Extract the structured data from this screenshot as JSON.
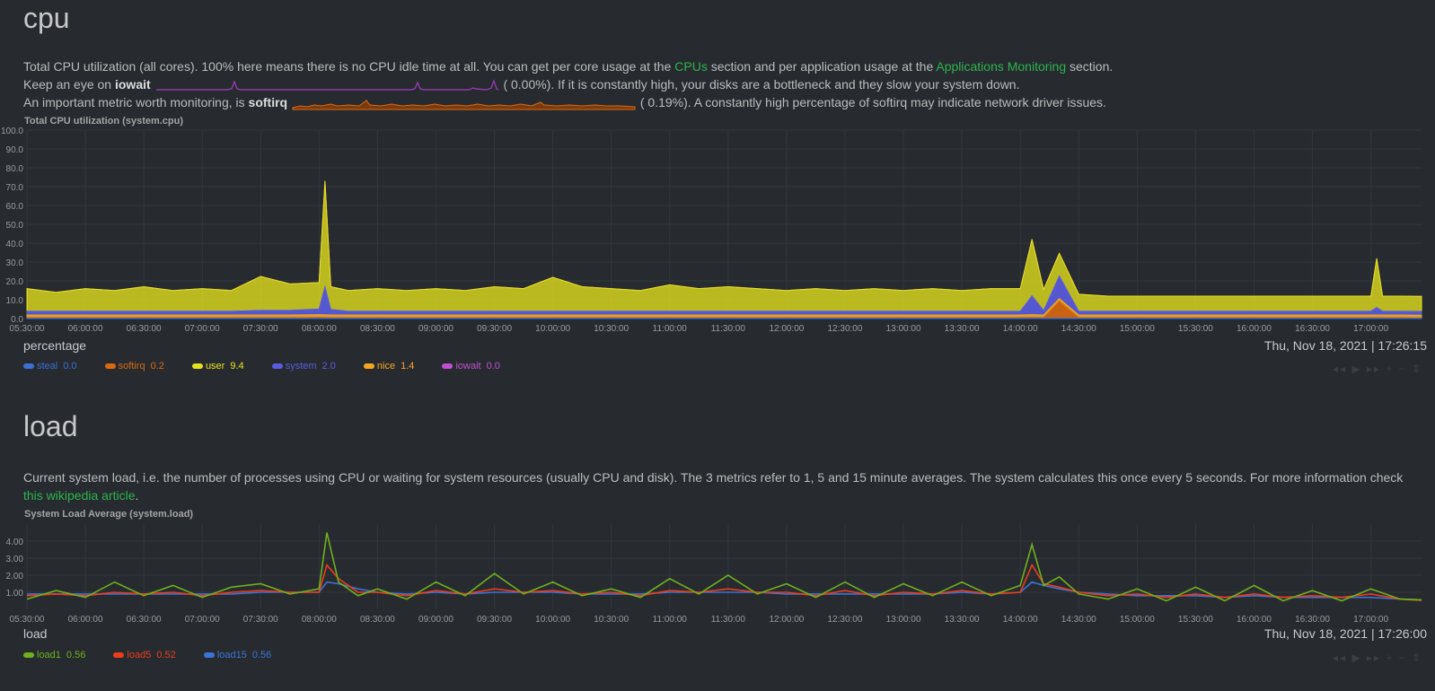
{
  "cpu": {
    "title": "cpu",
    "desc1_pre": "Total CPU utilization (all cores). 100% here means there is no CPU idle time at all. You can get per core usage at the ",
    "desc1_link1": "CPUs",
    "desc1_mid": " section and per application usage at the ",
    "desc1_link2": "Applications Monitoring",
    "desc1_post": " section.",
    "desc2_pre": "Keep an eye on ",
    "desc2_bold": "iowait",
    "desc2_val": "(       0.00%). If it is constantly high, your disks are a bottleneck and they slow your system down.",
    "desc3_pre": "An important metric worth monitoring, is ",
    "desc3_bold": "softirq",
    "desc3_val": "(       0.19%). A constantly high percentage of softirq may indicate network driver issues.",
    "chart_title": "Total CPU utilization (system.cpu)",
    "units": "percentage",
    "timestamp": "Thu, Nov 18, 2021 | 17:26:15",
    "legend": [
      {
        "name": "steal",
        "value": "0.0",
        "color": "#3b6fd6"
      },
      {
        "name": "softirq",
        "value": "0.2",
        "color": "#d9690f"
      },
      {
        "name": "user",
        "value": "9.4",
        "color": "#e5e21c"
      },
      {
        "name": "system",
        "value": "2.0",
        "color": "#5a5ce0"
      },
      {
        "name": "nice",
        "value": "1.4",
        "color": "#f5a623"
      },
      {
        "name": "iowait",
        "value": "0.0",
        "color": "#c04fd1"
      }
    ]
  },
  "load": {
    "title": "load",
    "desc1": "Current system load, i.e. the number of processes using CPU or waiting for system resources (usually CPU and disk). The 3 metrics refer to 1, 5 and 15 minute averages. The system calculates this once every 5 seconds. For more information check",
    "desc2_link": "this wikipedia article",
    "desc2_post": ".",
    "chart_title": "System Load Average (system.load)",
    "units": "load",
    "timestamp": "Thu, Nov 18, 2021 | 17:26:00",
    "legend": [
      {
        "name": "load1",
        "value": "0.56",
        "color": "#6fb01e"
      },
      {
        "name": "load5",
        "value": "0.52",
        "color": "#ec3c1c"
      },
      {
        "name": "load15",
        "value": "0.56",
        "color": "#3b73d6"
      }
    ]
  },
  "toolbar_glyphs": "◂◂ ▶ ▸▸ + −   ⇕",
  "chart_data": [
    {
      "type": "area",
      "title": "Total CPU utilization (system.cpu)",
      "ylabel": "percentage",
      "ylim": [
        0,
        100
      ],
      "yticks": [
        "0.0",
        "10.0",
        "20.0",
        "30.0",
        "40.0",
        "50.0",
        "60.0",
        "70.0",
        "80.0",
        "90.0",
        "100.0"
      ],
      "xticks": [
        "05:30:00",
        "06:00:00",
        "06:30:00",
        "07:00:00",
        "07:30:00",
        "08:00:00",
        "08:30:00",
        "09:00:00",
        "09:30:00",
        "10:00:00",
        "10:30:00",
        "11:00:00",
        "11:30:00",
        "12:00:00",
        "12:30:00",
        "13:00:00",
        "13:30:00",
        "14:00:00",
        "14:30:00",
        "15:00:00",
        "15:30:00",
        "16:00:00",
        "16:30:00",
        "17:00:00"
      ],
      "x": [
        "05:30",
        "05:45",
        "06:00",
        "06:15",
        "06:30",
        "06:45",
        "07:00",
        "07:15",
        "07:30",
        "07:45",
        "08:00",
        "08:03",
        "08:06",
        "08:15",
        "08:30",
        "08:45",
        "09:00",
        "09:15",
        "09:30",
        "09:45",
        "10:00",
        "10:15",
        "10:30",
        "10:45",
        "11:00",
        "11:15",
        "11:30",
        "11:45",
        "12:00",
        "12:15",
        "12:30",
        "12:45",
        "13:00",
        "13:15",
        "13:30",
        "13:45",
        "14:00",
        "14:06",
        "14:12",
        "14:20",
        "14:30",
        "14:45",
        "15:00",
        "15:15",
        "15:30",
        "15:45",
        "16:00",
        "16:15",
        "16:30",
        "16:45",
        "17:00",
        "17:03",
        "17:06",
        "17:15",
        "17:26"
      ],
      "series": [
        {
          "name": "steal",
          "color": "#3b6fd6",
          "values": [
            0.2,
            0.2,
            0.2,
            0.2,
            0.2,
            0.2,
            0.2,
            0.2,
            0.2,
            0.2,
            0.2,
            0.2,
            0.2,
            0.2,
            0.2,
            0.2,
            0.2,
            0.2,
            0.2,
            0.2,
            0.2,
            0.2,
            0.2,
            0.2,
            0.2,
            0.2,
            0.2,
            0.2,
            0.2,
            0.2,
            0.2,
            0.2,
            0.2,
            0.2,
            0.2,
            0.2,
            0.2,
            0.2,
            0.2,
            0.2,
            0.2,
            0.2,
            0.2,
            0.2,
            0.2,
            0.2,
            0.2,
            0.2,
            0.2,
            0.2,
            0.2,
            0.2,
            0.2,
            0.2,
            0.2
          ]
        },
        {
          "name": "softirq",
          "color": "#d9690f",
          "values": [
            0.3,
            0.3,
            0.3,
            0.3,
            0.3,
            0.3,
            0.3,
            0.3,
            0.3,
            0.3,
            0.5,
            0.4,
            0.3,
            0.3,
            0.3,
            0.3,
            0.3,
            0.3,
            0.3,
            0.3,
            0.3,
            0.3,
            0.3,
            0.3,
            0.3,
            0.3,
            0.3,
            0.3,
            0.3,
            0.3,
            0.3,
            0.3,
            0.3,
            0.3,
            0.3,
            0.3,
            0.3,
            0.5,
            0.3,
            9.0,
            0.3,
            0.3,
            0.3,
            0.3,
            0.3,
            0.3,
            0.3,
            0.3,
            0.3,
            0.3,
            0.3,
            0.3,
            0.3,
            0.3,
            0.2
          ]
        },
        {
          "name": "nice",
          "color": "#f5a623",
          "values": [
            1.4,
            1.4,
            1.4,
            1.4,
            1.4,
            1.4,
            1.4,
            1.4,
            1.4,
            1.4,
            1.4,
            1.4,
            1.4,
            1.4,
            1.4,
            1.4,
            1.4,
            1.4,
            1.4,
            1.4,
            1.4,
            1.4,
            1.4,
            1.4,
            1.4,
            1.4,
            1.4,
            1.4,
            1.4,
            1.4,
            1.4,
            1.4,
            1.4,
            1.4,
            1.4,
            1.4,
            1.4,
            1.4,
            1.4,
            1.4,
            1.4,
            1.4,
            1.4,
            1.4,
            1.4,
            1.4,
            1.4,
            1.4,
            1.4,
            1.4,
            1.4,
            1.4,
            1.4,
            1.4,
            1.4
          ]
        },
        {
          "name": "system",
          "color": "#5a5ce0",
          "values": [
            2.0,
            2.0,
            2.0,
            2.0,
            2.0,
            2.0,
            2.0,
            2.0,
            2.5,
            2.5,
            3.0,
            15.0,
            3.0,
            2.0,
            2.0,
            2.0,
            2.0,
            2.0,
            2.0,
            2.0,
            2.0,
            2.0,
            2.0,
            2.0,
            2.0,
            2.0,
            2.0,
            2.0,
            2.0,
            2.0,
            2.0,
            2.0,
            2.0,
            2.0,
            2.0,
            2.0,
            2.0,
            10.0,
            2.5,
            12.0,
            2.0,
            2.0,
            2.0,
            2.0,
            2.0,
            2.0,
            2.0,
            2.0,
            2.0,
            2.0,
            2.0,
            4.0,
            2.0,
            2.0,
            2.0
          ]
        },
        {
          "name": "user",
          "color": "#e5e21c",
          "values": [
            12,
            10,
            12,
            11,
            13,
            11,
            12,
            11,
            18,
            14,
            14,
            56,
            12,
            11,
            12,
            11,
            12,
            11,
            13,
            12,
            18,
            13,
            12,
            11,
            14,
            12,
            13,
            12,
            11,
            12,
            11,
            12,
            11,
            12,
            11,
            12,
            12,
            30,
            11,
            12,
            9,
            8,
            8,
            8,
            8,
            8,
            8,
            8,
            8,
            8,
            8,
            26,
            8,
            8,
            8
          ]
        },
        {
          "name": "iowait",
          "color": "#c04fd1",
          "values": [
            0,
            0,
            0,
            0,
            0,
            0,
            0,
            0,
            0,
            0,
            0,
            0,
            0,
            0,
            0,
            0,
            0,
            0,
            0,
            0,
            0,
            0,
            0,
            0,
            0,
            0,
            0,
            0,
            0,
            0,
            0,
            0,
            0,
            0,
            0,
            0,
            0,
            0,
            0,
            0,
            0,
            0,
            0,
            0,
            0,
            0,
            0,
            0,
            0,
            0,
            0,
            0,
            0,
            0,
            0
          ]
        }
      ]
    },
    {
      "type": "line",
      "title": "System Load Average (system.load)",
      "ylabel": "load",
      "ylim": [
        0,
        5
      ],
      "yticks": [
        "1.00",
        "2.00",
        "3.00",
        "4.00"
      ],
      "xticks": [
        "05:30:00",
        "06:00:00",
        "06:30:00",
        "07:00:00",
        "07:30:00",
        "08:00:00",
        "08:30:00",
        "09:00:00",
        "09:30:00",
        "10:00:00",
        "10:30:00",
        "11:00:00",
        "11:30:00",
        "12:00:00",
        "12:30:00",
        "13:00:00",
        "13:30:00",
        "14:00:00",
        "14:30:00",
        "15:00:00",
        "15:30:00",
        "16:00:00",
        "16:30:00",
        "17:00:00"
      ],
      "x": [
        "05:30",
        "05:45",
        "06:00",
        "06:15",
        "06:30",
        "06:45",
        "07:00",
        "07:15",
        "07:30",
        "07:45",
        "08:00",
        "08:04",
        "08:10",
        "08:20",
        "08:30",
        "08:45",
        "09:00",
        "09:15",
        "09:30",
        "09:45",
        "10:00",
        "10:15",
        "10:30",
        "10:45",
        "11:00",
        "11:15",
        "11:30",
        "11:45",
        "12:00",
        "12:15",
        "12:30",
        "12:45",
        "13:00",
        "13:15",
        "13:30",
        "13:45",
        "14:00",
        "14:06",
        "14:12",
        "14:20",
        "14:30",
        "14:45",
        "15:00",
        "15:15",
        "15:30",
        "15:45",
        "16:00",
        "16:15",
        "16:30",
        "16:45",
        "17:00",
        "17:15",
        "17:26"
      ],
      "series": [
        {
          "name": "load1",
          "color": "#6fb01e",
          "values": [
            0.6,
            1.1,
            0.7,
            1.6,
            0.8,
            1.4,
            0.7,
            1.3,
            1.5,
            0.9,
            1.2,
            4.5,
            1.6,
            0.8,
            1.2,
            0.6,
            1.6,
            0.8,
            2.1,
            0.9,
            1.6,
            0.8,
            1.2,
            0.7,
            1.8,
            0.9,
            2.0,
            0.9,
            1.5,
            0.7,
            1.6,
            0.7,
            1.5,
            0.8,
            1.6,
            0.8,
            1.4,
            3.8,
            1.4,
            1.9,
            0.9,
            0.6,
            1.2,
            0.5,
            1.3,
            0.5,
            1.4,
            0.5,
            1.1,
            0.5,
            1.2,
            0.6,
            0.56
          ]
        },
        {
          "name": "load5",
          "color": "#ec3c1c",
          "values": [
            0.8,
            0.9,
            0.8,
            1.0,
            0.9,
            1.0,
            0.8,
            1.0,
            1.1,
            1.0,
            1.0,
            2.6,
            1.8,
            1.0,
            1.0,
            0.8,
            1.1,
            0.9,
            1.2,
            1.0,
            1.1,
            0.9,
            1.0,
            0.8,
            1.1,
            1.0,
            1.2,
            1.0,
            1.0,
            0.8,
            1.1,
            0.8,
            1.0,
            0.9,
            1.1,
            0.9,
            1.0,
            2.6,
            1.5,
            1.3,
            1.0,
            0.8,
            0.9,
            0.7,
            0.9,
            0.7,
            0.9,
            0.7,
            0.8,
            0.7,
            0.9,
            0.6,
            0.52
          ]
        },
        {
          "name": "load15",
          "color": "#3b73d6",
          "values": [
            0.9,
            0.9,
            0.9,
            0.9,
            0.9,
            0.9,
            0.9,
            0.9,
            1.0,
            1.0,
            1.0,
            1.6,
            1.5,
            1.2,
            1.0,
            0.9,
            1.0,
            0.9,
            1.0,
            1.0,
            1.0,
            0.9,
            0.9,
            0.9,
            1.0,
            1.0,
            1.0,
            1.0,
            0.9,
            0.9,
            0.9,
            0.9,
            0.9,
            0.9,
            1.0,
            0.9,
            1.0,
            1.6,
            1.4,
            1.2,
            1.0,
            0.9,
            0.8,
            0.8,
            0.8,
            0.7,
            0.8,
            0.7,
            0.7,
            0.7,
            0.7,
            0.6,
            0.56
          ]
        }
      ]
    }
  ]
}
